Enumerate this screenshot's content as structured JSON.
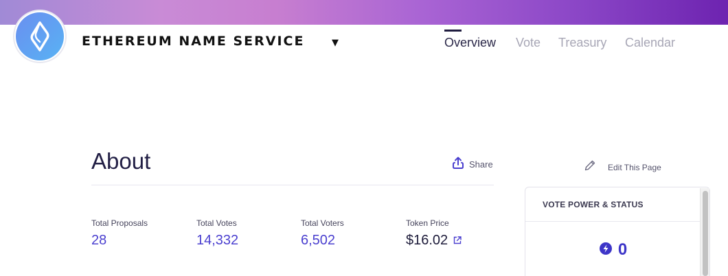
{
  "header": {
    "dao_name": "ETHEREUM NAME SERVICE",
    "logo_icon": "ens-logo-icon",
    "caret_icon": "caret-down-icon",
    "nav_tabs": [
      {
        "label": "Overview",
        "active": true
      },
      {
        "label": "Vote",
        "active": false
      },
      {
        "label": "Treasury",
        "active": false
      },
      {
        "label": "Calendar",
        "active": false
      }
    ]
  },
  "about": {
    "title": "About",
    "share_label": "Share",
    "share_icon": "share-upload-icon"
  },
  "stats": [
    {
      "label": "Total Proposals",
      "value": "28"
    },
    {
      "label": "Total Votes",
      "value": "14,332"
    },
    {
      "label": "Total Voters",
      "value": "6,502"
    },
    {
      "label": "Token Price",
      "value": "$16.02",
      "icon": "external-link-icon"
    }
  ],
  "sidebar": {
    "edit_label": "Edit This Page",
    "edit_icon": "pencil-icon",
    "vote_card_title": "VOTE POWER & STATUS",
    "vote_power_value": "0",
    "vote_power_icon": "bolt-icon"
  },
  "colors": {
    "accent": "#4a3fcf",
    "text_dark": "#1d1b3a",
    "nav_inactive": "#a7a6b5",
    "banner_start": "#a08ad6",
    "banner_end": "#6d23b0"
  }
}
